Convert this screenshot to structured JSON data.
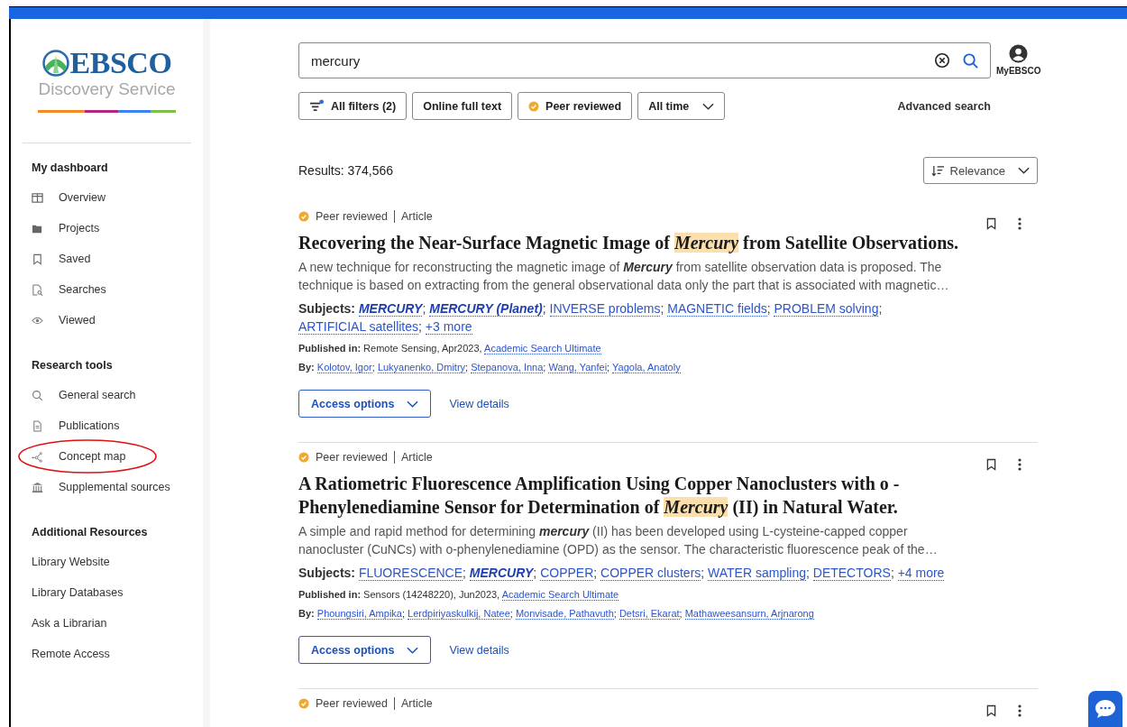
{
  "sidebar": {
    "logo": {
      "brand": "EBSCO",
      "subtitle": "Discovery Service"
    },
    "sections": [
      {
        "heading": "My dashboard",
        "items": [
          {
            "label": "Overview",
            "annotated": false
          },
          {
            "label": "Projects",
            "annotated": false
          },
          {
            "label": "Saved",
            "annotated": false
          },
          {
            "label": "Searches",
            "annotated": false
          },
          {
            "label": "Viewed",
            "annotated": false
          }
        ]
      },
      {
        "heading": "Research tools",
        "items": [
          {
            "label": "General search",
            "annotated": false
          },
          {
            "label": "Publications",
            "annotated": false
          },
          {
            "label": "Concept map",
            "annotated": true
          },
          {
            "label": "Supplemental sources",
            "annotated": false
          }
        ]
      },
      {
        "heading": "Additional Resources",
        "items": [
          {
            "label": "Library Website",
            "annotated": false
          },
          {
            "label": "Library Databases",
            "annotated": false
          },
          {
            "label": "Ask a Librarian",
            "annotated": false
          },
          {
            "label": "Remote Access",
            "annotated": false
          }
        ]
      }
    ]
  },
  "search": {
    "value": "mercury"
  },
  "account": {
    "label": "MyEBSCO"
  },
  "filters": [
    {
      "label": "All filters (2)",
      "kind": "filters"
    },
    {
      "label": "Online full text",
      "kind": "plain"
    },
    {
      "label": "Peer reviewed",
      "kind": "peer"
    },
    {
      "label": "All time",
      "kind": "dropdown"
    }
  ],
  "advanced_search": "Advanced search",
  "results_count": "Results: 374,566",
  "sort": {
    "label": "Relevance"
  },
  "results": [
    {
      "badge": "Peer reviewed",
      "type": "Article",
      "title": "Recovering the Near-Surface Magnetic Image of *Mercury* from Satellite Observations.",
      "abstract": "A new technique for reconstructing the magnetic image of **Mercury** from satellite observation data is proposed. The technique is based on extracting from the general observational data only the part that is associated with magnetic…",
      "subjects_label": "Subjects:",
      "subjects": [
        {
          "label": "MERCURY",
          "match": true,
          "sep": ";"
        },
        {
          "label": "MERCURY (Planet)",
          "match": true,
          "sep": ";"
        },
        {
          "label": "INVERSE problems",
          "match": false,
          "sep": ";"
        },
        {
          "label": "MAGNETIC fields",
          "match": false,
          "sep": ";"
        },
        {
          "label": "PROBLEM solving",
          "match": false,
          "sep": ";"
        },
        {
          "label": "ARTIFICIAL satellites",
          "match": false,
          "sep": ";"
        },
        {
          "label": "+3 more",
          "match": false
        }
      ],
      "published_label": "Published in:",
      "published_source": "Remote Sensing, Apr2023,",
      "database": "Academic Search Ultimate",
      "authors_label": "By:",
      "authors": [
        {
          "name": "Kolotov, Igor",
          "sep": ";"
        },
        {
          "name": "Lukyanenko, Dmitry",
          "sep": ";"
        },
        {
          "name": "Stepanova, Inna",
          "sep": ";"
        },
        {
          "name": "Wang, Yanfei",
          "sep": ";"
        },
        {
          "name": "Yagola, Anatoly"
        }
      ],
      "access": "Access options",
      "details": "View details"
    },
    {
      "badge": "Peer reviewed",
      "type": "Article",
      "title": "A Ratiometric Fluorescence Amplification Using Copper Nanoclusters with o - Phenylenediamine Sensor for Determination of *Mercury* (II) in Natural Water.",
      "abstract": "A simple and rapid method for determining **mercury** (II) has been developed using L-cysteine-capped copper nanocluster (CuNCs) with o-phenylenediamine (OPD) as the sensor. The characteristic fluorescence peak of the…",
      "subjects_label": "Subjects:",
      "subjects": [
        {
          "label": "FLUORESCENCE",
          "match": false,
          "sep": ";"
        },
        {
          "label": "MERCURY",
          "match": true,
          "sep": ";"
        },
        {
          "label": "COPPER",
          "match": false,
          "sep": ";"
        },
        {
          "label": "COPPER clusters",
          "match": false,
          "sep": ";"
        },
        {
          "label": "WATER sampling",
          "match": false,
          "sep": ";"
        },
        {
          "label": "DETECTORS",
          "match": false,
          "sep": ";"
        },
        {
          "label": "+4 more",
          "match": false
        }
      ],
      "published_label": "Published in:",
      "published_source": "Sensors (14248220), Jun2023,",
      "database": "Academic Search Ultimate",
      "authors_label": "By:",
      "authors": [
        {
          "name": "Phoungsiri, Ampika",
          "sep": ";"
        },
        {
          "name": "Lerdpiriyaskulkij, Natee",
          "sep": ";"
        },
        {
          "name": "Monvisade, Pathavuth",
          "sep": ";"
        },
        {
          "name": "Detsri, Ekarat",
          "sep": ";"
        },
        {
          "name": "Mathaweesansurn, Arjnarong"
        }
      ],
      "access": "Access options",
      "details": "View details"
    },
    {
      "badge": "Peer reviewed",
      "type": "Article"
    }
  ]
}
